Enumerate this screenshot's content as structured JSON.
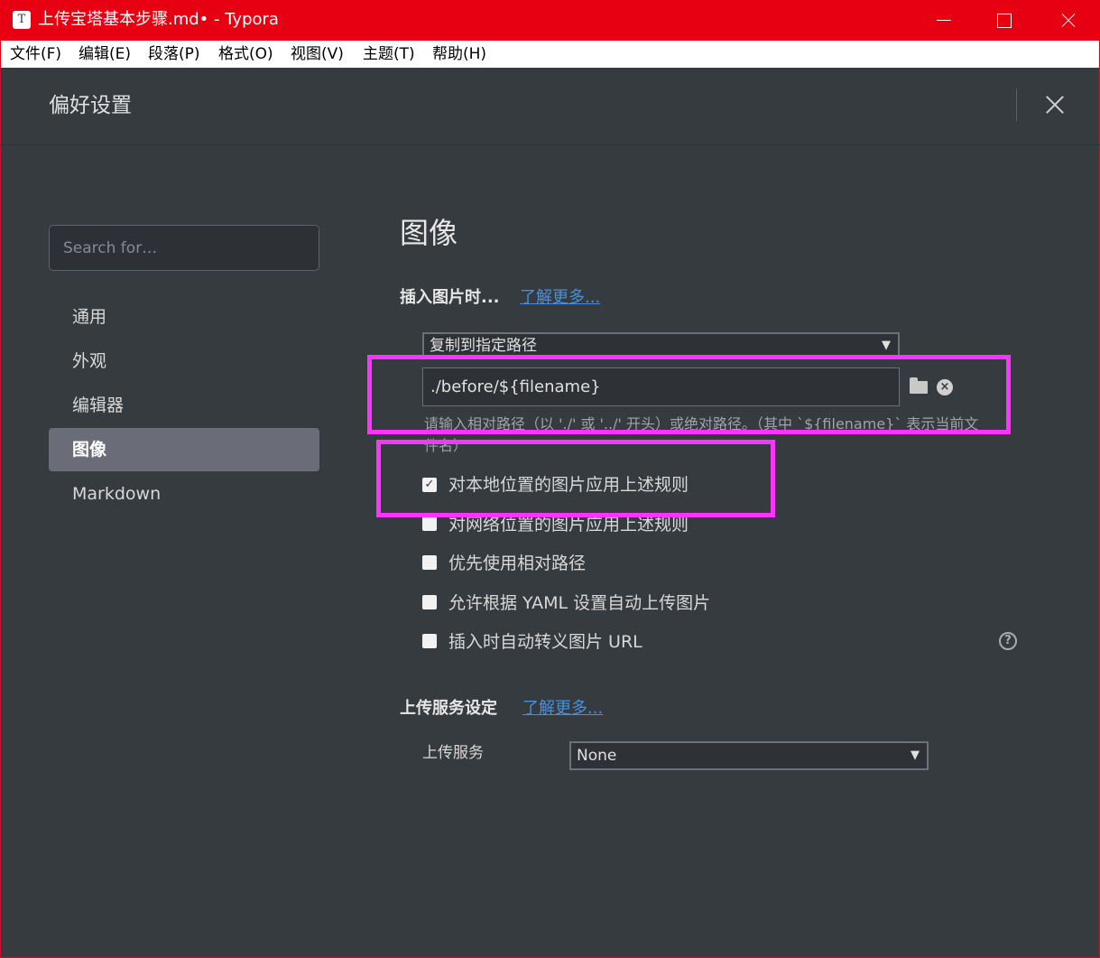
{
  "window": {
    "title": "上传宝塔基本步骤.md• - Typora",
    "app_icon_glyph": "T",
    "accent_color": "#e60012"
  },
  "menu": [
    "文件(F)",
    "编辑(E)",
    "段落(P)",
    "格式(O)",
    "视图(V)",
    "主题(T)",
    "帮助(H)"
  ],
  "preferences": {
    "title": "偏好设置",
    "search_placeholder": "Search for…",
    "nav": [
      "通用",
      "外观",
      "编辑器",
      "图像",
      "Markdown"
    ],
    "active_nav": "图像"
  },
  "image_section": {
    "title": "图像",
    "insert_heading": "插入图片时...",
    "learn_more": "了解更多...",
    "insert_action": "复制到指定路径",
    "path_value": "./before/${filename}",
    "path_hint": "请输入相对路径（以 './' 或 '../' 开头）或绝对路径。（其中 `${filename}` 表示当前文件名）",
    "options": [
      {
        "label": "对本地位置的图片应用上述规则",
        "checked": true
      },
      {
        "label": "对网络位置的图片应用上述规则",
        "checked": false
      },
      {
        "label": "优先使用相对路径",
        "checked": false
      },
      {
        "label": "允许根据 YAML 设置自动上传图片",
        "checked": false
      },
      {
        "label": "插入时自动转义图片 URL",
        "checked": false
      }
    ],
    "help_glyph": "?"
  },
  "upload_section": {
    "heading": "上传服务设定",
    "learn_more": "了解更多...",
    "service_label": "上传服务",
    "service_value": "None"
  },
  "annotation_color": "#ff33ff"
}
